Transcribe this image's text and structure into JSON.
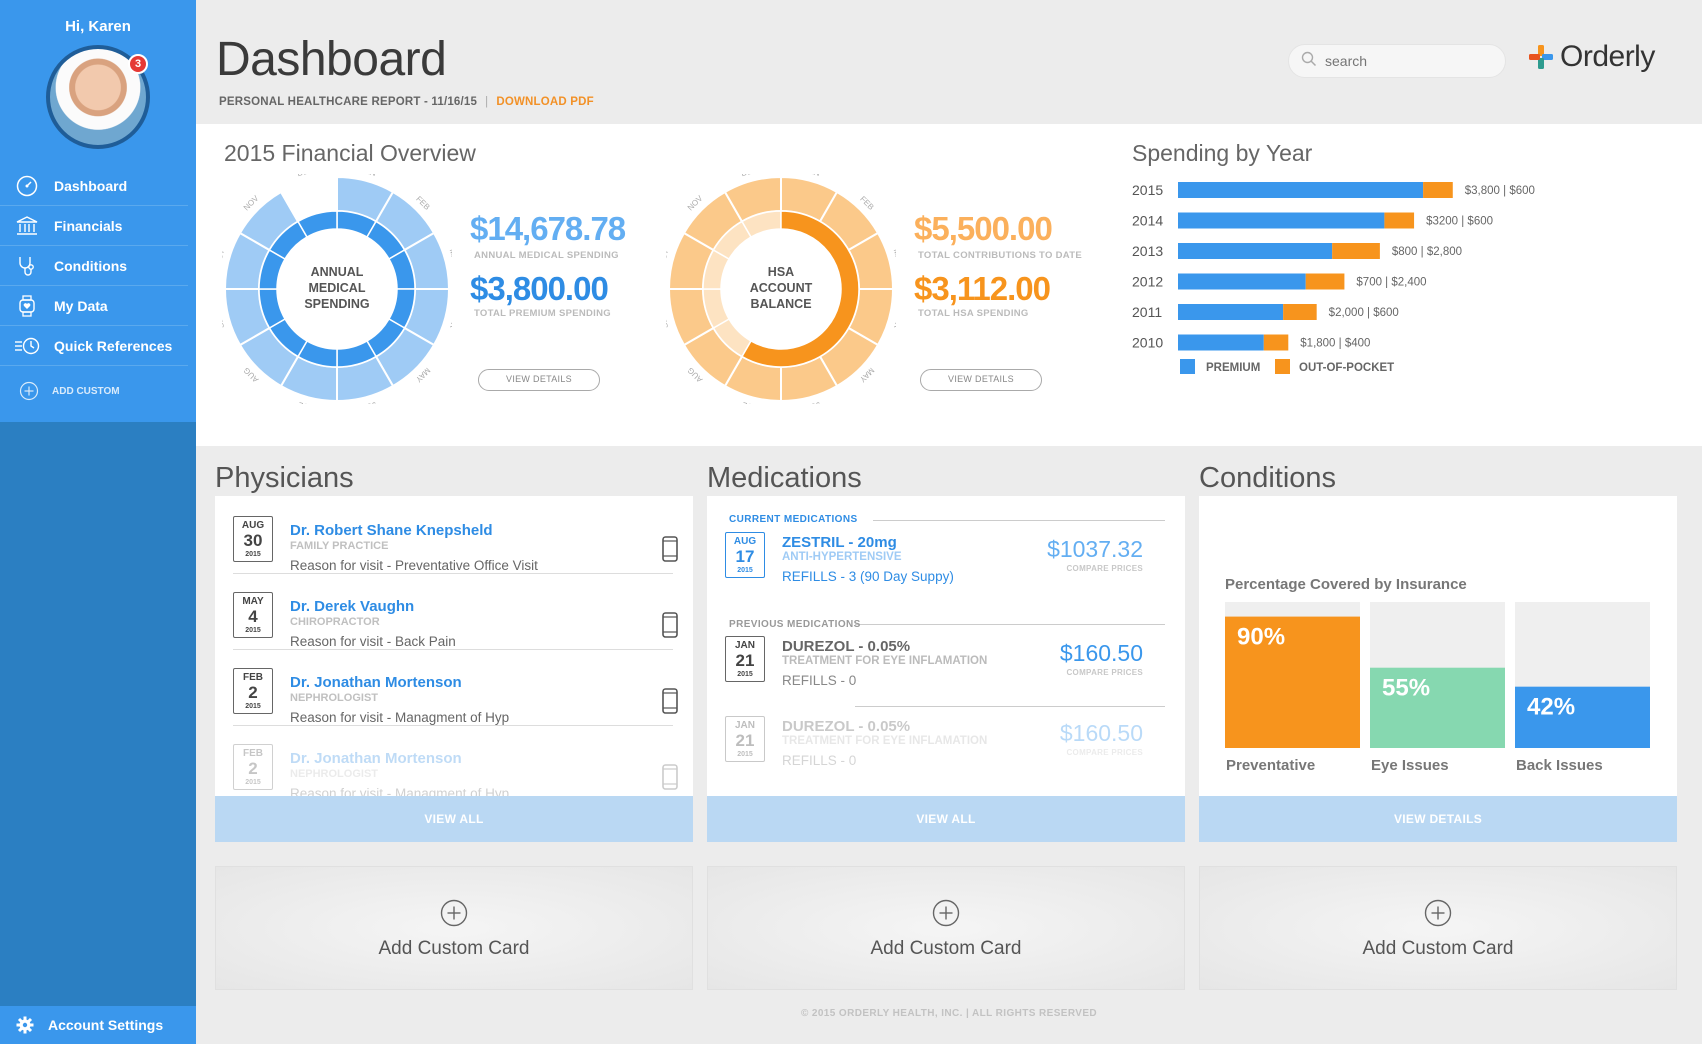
{
  "sidebar": {
    "greeting": "Hi, Karen",
    "notification_count": "3",
    "items": [
      {
        "label": "Dashboard",
        "icon": "speedometer-icon"
      },
      {
        "label": "Financials",
        "icon": "bank-icon"
      },
      {
        "label": "Conditions",
        "icon": "stethoscope-icon"
      },
      {
        "label": "My Data",
        "icon": "watch-heart-icon"
      },
      {
        "label": "Quick References",
        "icon": "list-clock-icon"
      }
    ],
    "add_custom": "ADD CUSTOM",
    "settings": "Account Settings"
  },
  "header": {
    "title": "Dashboard",
    "report": "PERSONAL HEALTHCARE REPORT - 11/16/15",
    "separator": "|",
    "download": "DOWNLOAD PDF",
    "search_placeholder": "search",
    "logo": "Orderly"
  },
  "overview": {
    "title": "2015 Financial Overview",
    "months": [
      "JAN",
      "FEB",
      "MAR",
      "APR",
      "MAY",
      "JUN",
      "JUL",
      "AUG",
      "SEP",
      "OCT",
      "NOV",
      "DEC"
    ],
    "medical": {
      "center": [
        "ANNUAL",
        "MEDICAL",
        "SPENDING"
      ],
      "amount": "$14,678.78",
      "amount_caption": "ANNUAL MEDICAL SPENDING",
      "amount2": "$3,800.00",
      "amount2_caption": "TOTAL PREMIUM SPENDING",
      "button": "VIEW DETAILS"
    },
    "hsa": {
      "center": [
        "HSA",
        "ACCOUNT",
        "BALANCE"
      ],
      "amount": "$5,500.00",
      "amount_caption": "TOTAL CONTRIBUTIONS TO DATE",
      "amount2": "$3,112.00",
      "amount2_caption": "TOTAL HSA SPENDING",
      "button": "VIEW DETAILS"
    },
    "colors": {
      "blue": "#3a97ec",
      "light_blue": "#9fcbf5",
      "orange": "#f7941d",
      "light_orange": "#fbc98a"
    }
  },
  "spending": {
    "title": "Spending by Year",
    "legend": {
      "premium": "PREMIUM",
      "oop": "OUT-OF-POCKET"
    }
  },
  "chart_data": [
    {
      "type": "bar",
      "title": "Spending by Year",
      "categories": [
        "2015",
        "2014",
        "2013",
        "2012",
        "2011",
        "2010"
      ],
      "series": [
        {
          "name": "PREMIUM",
          "values": [
            3800,
            3200,
            2390,
            1980,
            1630,
            1330
          ]
        },
        {
          "name": "OUT-OF-POCKET",
          "values": [
            460,
            460,
            740,
            600,
            520,
            380
          ]
        }
      ],
      "data_labels": [
        "$3,800 | $600",
        "$3200 | $600",
        "$800 | $2,800",
        "$700 | $2,400",
        "$2,000 | $600",
        "$1,800 | $400"
      ],
      "colors": [
        "#3a97ec",
        "#f7941d"
      ]
    },
    {
      "type": "bar",
      "title": "Percentage Covered by Insurance",
      "categories": [
        "Preventative",
        "Eye Issues",
        "Back Issues"
      ],
      "values": [
        90,
        55,
        42
      ],
      "value_labels": [
        "90%",
        "55%",
        "42%"
      ],
      "ylim": [
        0,
        100
      ],
      "colors": [
        "#f7941d",
        "#86d8b0",
        "#3a97ec"
      ]
    }
  ],
  "physicians": {
    "title": "Physicians",
    "items": [
      {
        "mon": "AUG",
        "day": "30",
        "yr": "2015",
        "name": "Dr. Robert Shane Knepsheld",
        "spec": "FAMILY PRACTICE",
        "reason": "Reason for visit - Preventative Office Visit"
      },
      {
        "mon": "MAY",
        "day": "4",
        "yr": "2015",
        "name": "Dr. Derek Vaughn",
        "spec": "CHIROPRACTOR",
        "reason": "Reason for visit - Back Pain"
      },
      {
        "mon": "FEB",
        "day": "2",
        "yr": "2015",
        "name": "Dr. Jonathan Mortenson",
        "spec": "NEPHROLOGIST",
        "reason": "Reason for visit - Managment of Hyp"
      },
      {
        "mon": "FEB",
        "day": "2",
        "yr": "2015",
        "name": "Dr. Jonathan Mortenson",
        "spec": "NEPHROLOGIST",
        "reason": "Reason for visit - Managment of Hyp"
      }
    ],
    "button": "VIEW ALL"
  },
  "medications": {
    "title": "Medications",
    "current_label": "CURRENT MEDICATIONS",
    "previous_label": "PREVIOUS MEDICATIONS",
    "compare": "COMPARE PRICES",
    "items": [
      {
        "mon": "AUG",
        "day": "17",
        "yr": "2015",
        "name": "ZESTRIL - 20mg",
        "desc": "ANTI-HYPERTENSIVE",
        "refills": "REFILLS - 3 (90 Day Suppy)",
        "price": "$1037.32"
      },
      {
        "mon": "JAN",
        "day": "21",
        "yr": "2015",
        "name": "DUREZOL - 0.05%",
        "desc": "TREATMENT FOR EYE INFLAMATION",
        "refills": "REFILLS - 0",
        "price": "$160.50"
      },
      {
        "mon": "JAN",
        "day": "21",
        "yr": "2015",
        "name": "DUREZOL - 0.05%",
        "desc": "TREATMENT FOR EYE INFLAMATION",
        "refills": "REFILLS - 0",
        "price": "$160.50"
      }
    ],
    "button": "VIEW ALL"
  },
  "conditions": {
    "title": "Conditions",
    "chart_title": "Percentage Covered by Insurance",
    "button": "VIEW DETAILS"
  },
  "add_card": "Add Custom Card",
  "footer": "© 2015 ORDERLY HEALTH, INC.   |   ALL RIGHTS RESERVED"
}
